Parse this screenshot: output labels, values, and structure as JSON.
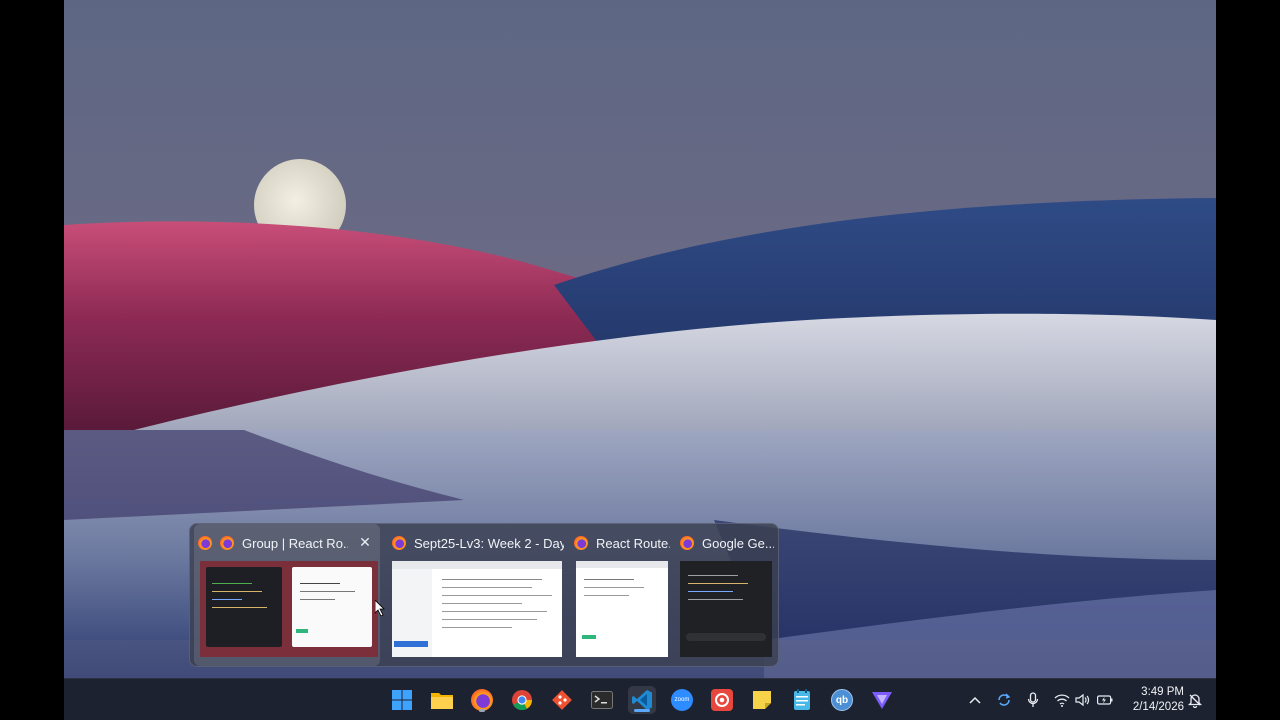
{
  "taskbar": {
    "apps": [
      {
        "name": "start-button-icon"
      },
      {
        "name": "file-explorer-icon"
      },
      {
        "name": "firefox-icon"
      },
      {
        "name": "chrome-icon"
      },
      {
        "name": "git-icon"
      },
      {
        "name": "terminal-icon"
      },
      {
        "name": "vscode-icon"
      },
      {
        "name": "zoom-icon",
        "label": "zoom"
      },
      {
        "name": "screen-recorder-icon"
      },
      {
        "name": "sticky-notes-icon"
      },
      {
        "name": "notepad-icon"
      },
      {
        "name": "qbittorrent-icon",
        "label": "qb"
      },
      {
        "name": "vpn-icon"
      }
    ],
    "clock": {
      "time": "3:49 PM",
      "date": "2/14/2026"
    }
  },
  "preview": {
    "items": [
      {
        "title": "Group | React Ro...",
        "close": "✕"
      },
      {
        "title": "Sept25-Lv3: Week 2 - Day..."
      },
      {
        "title": "React Route..."
      },
      {
        "title": "Google Ge..."
      }
    ]
  },
  "colors": {
    "accent": "#5aa9ff",
    "taskbar": "#1d2230",
    "firefox": "#ff7139"
  }
}
